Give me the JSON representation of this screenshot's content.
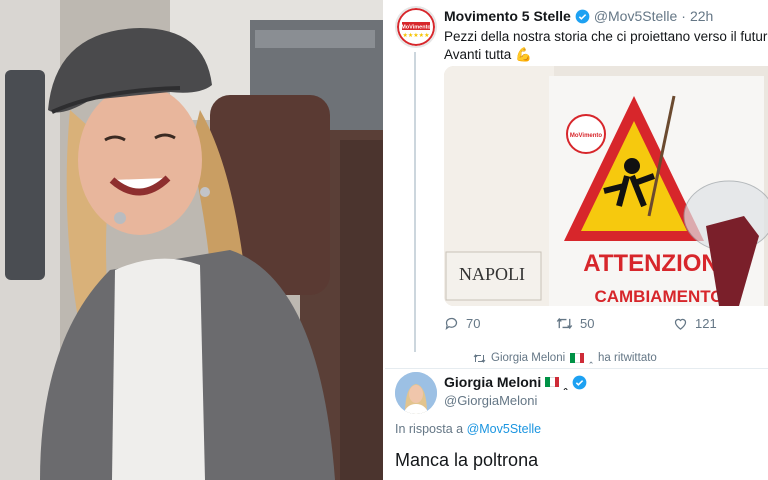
{
  "original_tweet": {
    "display_name": "Movimento 5 Stelle",
    "handle": "@Mov5Stelle",
    "separator": "·",
    "time": "22h",
    "text_line1": "Pezzi della nostra storia che ci proiettano verso il futuro",
    "text_line2": "Avanti tutta",
    "avatar_logo_text": "MoVimento",
    "media": {
      "book_title": "NAPOLI",
      "sign_text": "ATTENZIONE",
      "sign_subtext": "CAMBIAMENTO",
      "logo_text": "MoVimento"
    },
    "replies_count": "70",
    "retweets_count": "50",
    "likes_count": "121"
  },
  "retweet_note": {
    "name": "Giorgia Meloni",
    "suffix": "ha ritwittato"
  },
  "reply_tweet": {
    "display_name": "Giorgia Meloni",
    "handle": "@GiorgiaMeloni",
    "reply_prefix": "In risposta a",
    "reply_target": "@Mov5Stelle",
    "text": "Manca la poltrona"
  },
  "colors": {
    "twitter_blue": "#1da1f2",
    "link_blue": "#1b95e0",
    "muted_gray": "#657786",
    "heart_red": "#e0245e"
  },
  "icons": [
    "verified-icon",
    "reply-icon",
    "retweet-icon",
    "like-icon",
    "heart-emoji-icon",
    "flexed-biceps-icon",
    "italy-flag-icon"
  ]
}
